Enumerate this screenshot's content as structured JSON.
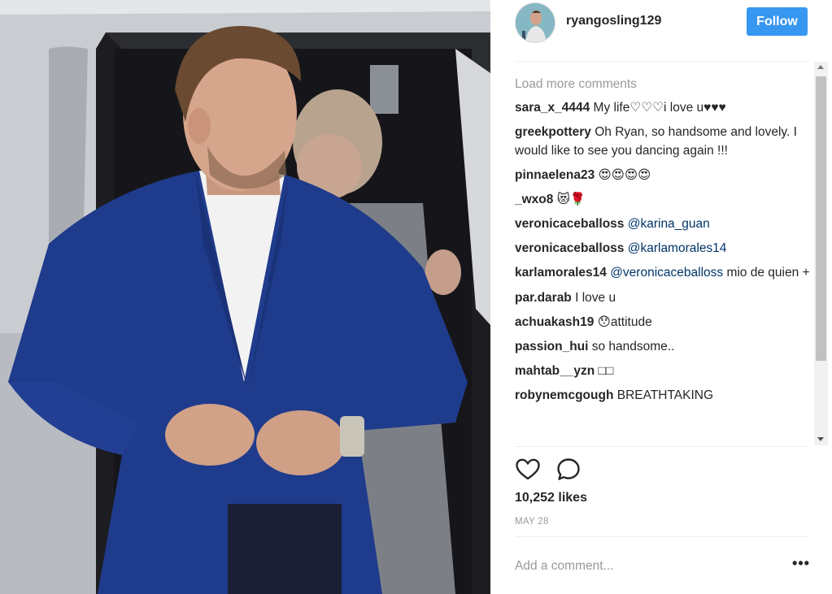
{
  "post": {
    "username": "ryangosling129",
    "follow_label": "Follow",
    "load_more": "Load more comments",
    "likes": "10,252 likes",
    "date": "MAY 28",
    "add_comment_placeholder": "Add a comment...",
    "more_options": "•••"
  },
  "comments": [
    {
      "user": "sara_x_4444",
      "text": " My life♡♡♡i love u♥♥♥",
      "mention": ""
    },
    {
      "user": "greekpottery",
      "text": " Oh Ryan, so handsome and lovely. I would like to see you dancing again !!!",
      "mention": ""
    },
    {
      "user": "pinnaelena23",
      "text": " 😍😍😍😍",
      "mention": ""
    },
    {
      "user": "_wxo8",
      "text": " 😻🌹",
      "mention": ""
    },
    {
      "user": "veronicaceballoss",
      "text": "",
      "mention": " @karina_guan"
    },
    {
      "user": "veronicaceballoss",
      "text": "",
      "mention": " @karlamorales14"
    },
    {
      "user": "karlamorales14",
      "text": " mio de quien +",
      "mention": " @veronicaceballoss"
    },
    {
      "user": "par.darab",
      "text": " I love u",
      "mention": ""
    },
    {
      "user": "achuakash19",
      "text": " 😯attitude",
      "mention": ""
    },
    {
      "user": "passion_hui",
      "text": " so handsome..",
      "mention": ""
    },
    {
      "user": "mahtab__yzn",
      "text": " □□",
      "mention": ""
    },
    {
      "user": "robynemcgough",
      "text": " BREATHTAKING",
      "mention": ""
    }
  ],
  "icons": {
    "like": "heart-icon",
    "comment": "comment-bubble-icon",
    "options": "more-options-icon"
  },
  "colors": {
    "follow_button": "#3897f0",
    "mention": "#003569",
    "muted": "#999999"
  }
}
